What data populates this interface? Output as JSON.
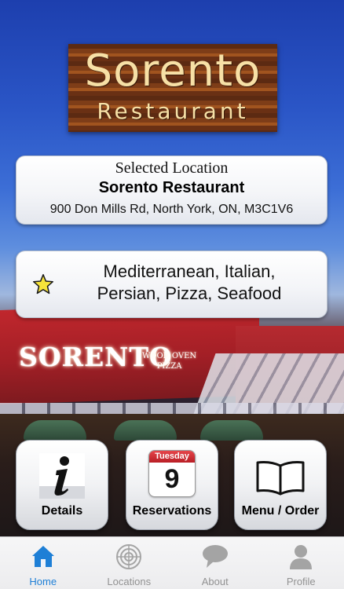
{
  "logo": {
    "title": "Sorento",
    "subtitle": "Restaurant"
  },
  "building_sign": {
    "name": "SORENTO",
    "line1": "WOOD OVEN",
    "line2": "PIZZA"
  },
  "selected_location": {
    "label": "Selected Location",
    "name": "Sorento Restaurant",
    "address": "900 Don Mills Rd, North York, ON, M3C1V6"
  },
  "cuisine": {
    "line1": "Mediterranean, Italian,",
    "line2": "Persian, Pizza, Seafood",
    "icon": "star-icon"
  },
  "actions": [
    {
      "label": "Details",
      "icon": "info-icon"
    },
    {
      "label": "Reservations",
      "icon": "calendar-icon",
      "calendar_day": "Tuesday",
      "calendar_date": "9"
    },
    {
      "label": "Menu / Order",
      "icon": "book-icon"
    }
  ],
  "tabs": [
    {
      "label": "Home",
      "icon": "home-icon",
      "active": true
    },
    {
      "label": "Locations",
      "icon": "radar-icon",
      "active": false
    },
    {
      "label": "About",
      "icon": "speech-bubble-icon",
      "active": false
    },
    {
      "label": "Profile",
      "icon": "person-icon",
      "active": false
    }
  ],
  "colors": {
    "accent": "#1e7fd6",
    "tab_inactive": "#929292",
    "logo_text": "#f7e0a6",
    "star": "#f6e33a"
  }
}
